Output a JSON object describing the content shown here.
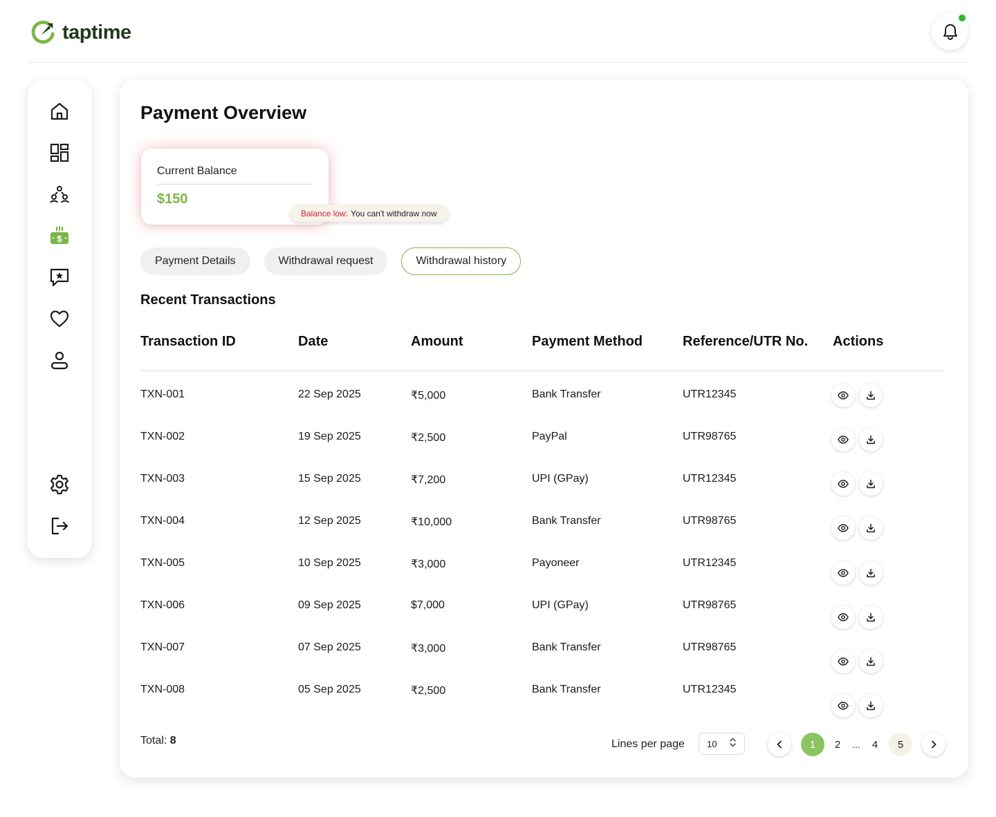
{
  "app": {
    "name": "taptime"
  },
  "header": {
    "notification_badge_color": "#2eb82e"
  },
  "sidebar": {
    "items": [
      {
        "name": "home",
        "icon": "home-icon"
      },
      {
        "name": "dashboard",
        "icon": "dashboard-icon"
      },
      {
        "name": "community",
        "icon": "people-icon"
      },
      {
        "name": "payments",
        "icon": "money-icon",
        "active": true
      },
      {
        "name": "reviews",
        "icon": "chat-star-icon"
      },
      {
        "name": "favorites",
        "icon": "heart-icon"
      },
      {
        "name": "profile",
        "icon": "user-icon"
      },
      {
        "name": "settings",
        "icon": "gear-icon"
      },
      {
        "name": "logout",
        "icon": "logout-icon"
      }
    ]
  },
  "page": {
    "title": "Payment Overview"
  },
  "balance": {
    "label": "Current Balance",
    "value": "$150",
    "warning_strong": "Balance low:",
    "warning_text": "You can't withdraw now"
  },
  "tabs": [
    {
      "label": "Payment Details",
      "active": false
    },
    {
      "label": "Withdrawal request",
      "active": false
    },
    {
      "label": "Withdrawal history",
      "active": true
    }
  ],
  "transactions": {
    "title": "Recent Transactions",
    "columns": [
      "Transaction ID",
      "Date",
      "Amount",
      "Payment Method",
      "Reference/UTR No.",
      "Actions"
    ],
    "rows": [
      {
        "id": "TXN-001",
        "date": "22 Sep 2025",
        "amount": "₹5,000",
        "method": "Bank Transfer",
        "ref": "UTR12345"
      },
      {
        "id": "TXN-002",
        "date": "19 Sep 2025",
        "amount": "₹2,500",
        "method": "PayPal",
        "ref": "UTR98765"
      },
      {
        "id": "TXN-003",
        "date": "15 Sep 2025",
        "amount": "₹7,200",
        "method": "UPI (GPay)",
        "ref": "UTR12345"
      },
      {
        "id": "TXN-004",
        "date": "12 Sep 2025",
        "amount": "₹10,000",
        "method": "Bank Transfer",
        "ref": "UTR98765"
      },
      {
        "id": "TXN-005",
        "date": "10 Sep 2025",
        "amount": "₹3,000",
        "method": "Payoneer",
        "ref": "UTR12345"
      },
      {
        "id": "TXN-006",
        "date": "09 Sep 2025",
        "amount": "$7,000",
        "method": "UPI (GPay)",
        "ref": "UTR98765"
      },
      {
        "id": "TXN-007",
        "date": "07 Sep 2025",
        "amount": "₹3,000",
        "method": "Bank Transfer",
        "ref": "UTR98765"
      },
      {
        "id": "TXN-008",
        "date": "05 Sep 2025",
        "amount": "₹2,500",
        "method": "Bank Transfer",
        "ref": "UTR12345"
      }
    ]
  },
  "footer": {
    "total_label": "Total:",
    "total_value": "8",
    "lines_per_page_label": "Lines per page",
    "lines_per_page_value": "10",
    "pages": [
      "1",
      "2",
      "...",
      "4",
      "5"
    ],
    "current_page": "1"
  },
  "colors": {
    "accent": "#7ab648",
    "warning": "#d11f2f"
  }
}
